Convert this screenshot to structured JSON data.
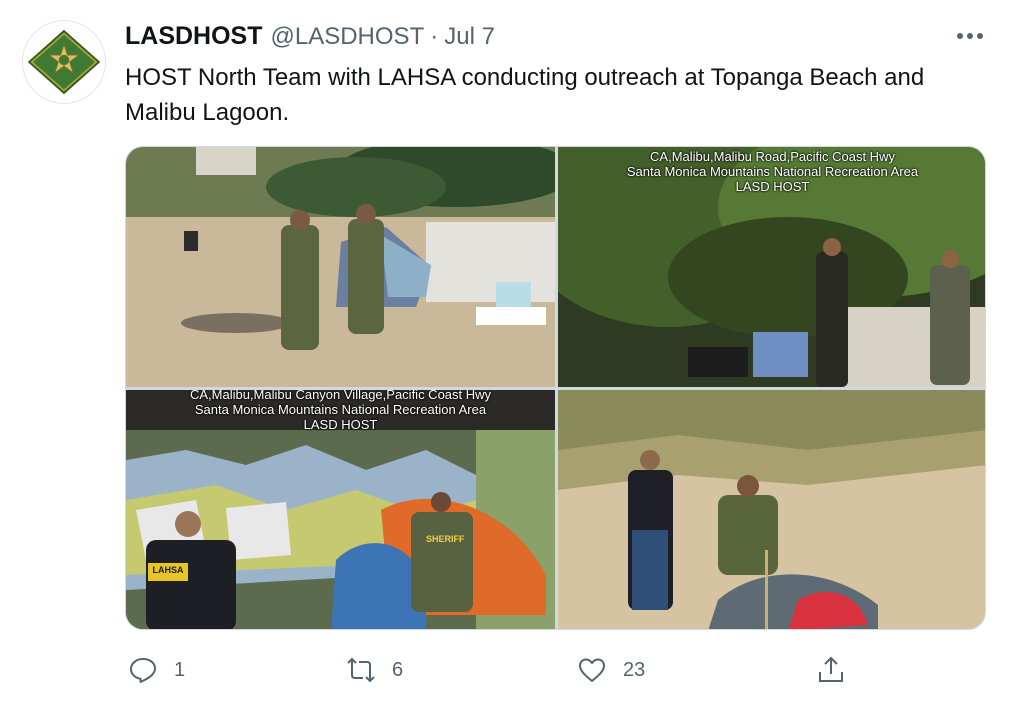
{
  "tweet": {
    "author_name": "LASDHOST",
    "handle": "@LASDHOST",
    "separator": "·",
    "date": "Jul 7",
    "text": "HOST North Team with LAHSA conducting outreach at Topanga Beach and Malibu Lagoon.",
    "avatar_icon": "sheriff-star-badge-icon"
  },
  "media": {
    "photos": [
      {
        "caption_lines": []
      },
      {
        "caption_lines": [
          "CA,Malibu,Malibu Road,Pacific Coast Hwy",
          "Santa Monica Mountains National Recreation Area",
          "LASD HOST"
        ]
      },
      {
        "caption_lines": [
          "CA,Malibu,Malibu Canyon Village,Pacific Coast Hwy",
          "Santa Monica Mountains National Recreation Area",
          "LASD HOST"
        ]
      },
      {
        "caption_lines": []
      }
    ],
    "vest_label": "SHERIFF",
    "shirt_label": "LAHSA"
  },
  "actions": {
    "reply_count": "1",
    "retweet_count": "6",
    "like_count": "23"
  },
  "colors": {
    "text_primary": "#0f1419",
    "text_secondary": "#536471",
    "badge_green": "#3f7a35",
    "badge_gold": "#c9a227"
  }
}
